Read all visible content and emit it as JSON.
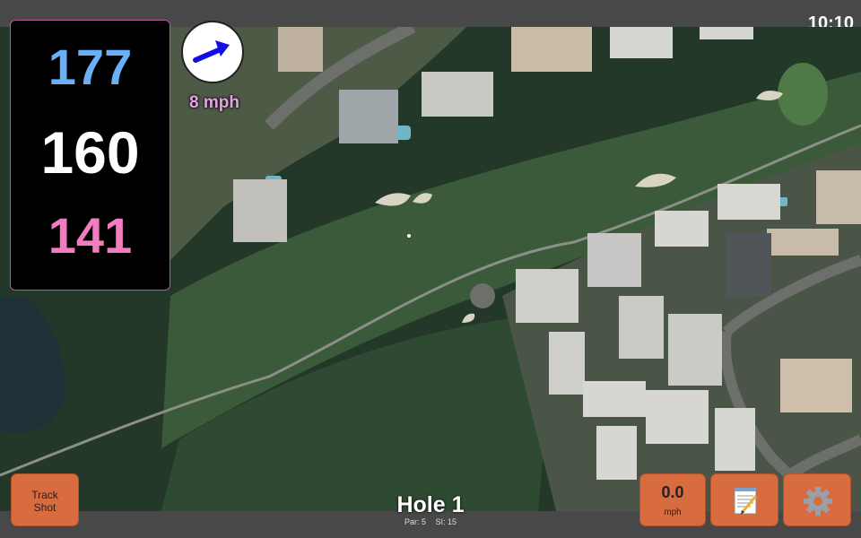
{
  "status": {
    "time": "10:10"
  },
  "distances": {
    "back": "177",
    "center": "160",
    "front": "141",
    "back_color": "#6ab0f5",
    "center_color": "#ffffff",
    "front_color": "#f27cc0"
  },
  "wind": {
    "speed": "8 mph",
    "arrow_icon": "arrow-right-icon",
    "arrow_color": "#1010e0"
  },
  "hole": {
    "title": "Hole 1",
    "par": "Par: 5",
    "si": "SI: 15"
  },
  "buttons": {
    "track_shot": "Track Shot",
    "speed_value": "0.0",
    "speed_unit": "mph",
    "notes_icon": "notepad-icon",
    "settings_icon": "gear-icon"
  },
  "colors": {
    "button_bg": "#d96c3e",
    "panel_border": "#b75a97"
  }
}
